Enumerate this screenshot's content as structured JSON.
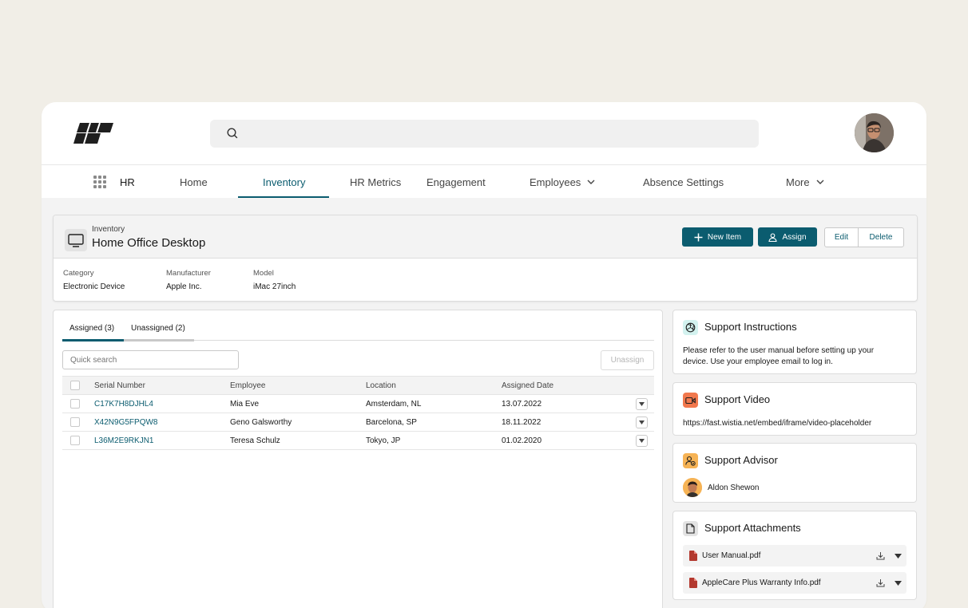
{
  "search": {
    "placeholder": ""
  },
  "nav": {
    "app_name": "HR",
    "items": [
      {
        "label": "Home"
      },
      {
        "label": "Inventory"
      },
      {
        "label": "HR Metrics"
      },
      {
        "label": "Engagement"
      },
      {
        "label": "Employees"
      },
      {
        "label": "Absence Settings"
      },
      {
        "label": "More"
      }
    ]
  },
  "record": {
    "object": "Inventory",
    "title": "Home Office Desktop",
    "buttons": {
      "new_item": "New Item",
      "assign": "Assign",
      "edit": "Edit",
      "delete": "Delete"
    },
    "fields": [
      {
        "label": "Category",
        "value": "Electronic Device"
      },
      {
        "label": "Manufacturer",
        "value": "Apple Inc."
      },
      {
        "label": "Model",
        "value": "iMac 27inch"
      }
    ]
  },
  "assignments": {
    "tabs": [
      {
        "label": "Assigned (3)"
      },
      {
        "label": "Unassigned (2)"
      }
    ],
    "quick_search_placeholder": "Quick search",
    "unassign_label": "Unassign",
    "columns": [
      "Serial Number",
      "Employee",
      "Location",
      "Assigned Date"
    ],
    "rows": [
      {
        "serial": "C17K7H8DJHL4",
        "employee": "Mia Eve",
        "location": "Amsterdam, NL",
        "date": "13.07.2022"
      },
      {
        "serial": "X42N9G5FPQW8",
        "employee": "Geno Galsworthy",
        "location": "Barcelona, SP",
        "date": "18.11.2022"
      },
      {
        "serial": "L36M2E9RKJN1",
        "employee": "Teresa Schulz",
        "location": "Tokyo, JP",
        "date": "01.02.2020"
      }
    ]
  },
  "side": {
    "instructions": {
      "title": "Support Instructions",
      "text_line1": "Please refer to the user manual before setting up your",
      "text_line2": "device. Use your employee email to log in."
    },
    "video": {
      "title": "Support Video",
      "url": "https://fast.wistia.net/embed/iframe/video-placeholder"
    },
    "advisor": {
      "title": "Support Advisor",
      "name": "Aldon Shewon"
    },
    "attachments": {
      "title": "Support Attachments",
      "files": [
        {
          "name": "User Manual.pdf"
        },
        {
          "name": "AppleCare Plus Warranty Info.pdf"
        }
      ]
    }
  },
  "colors": {
    "brand": "#0b5c6f",
    "background": "#f1eee7",
    "video_icon": "#f1784d",
    "advisor_icon": "#f6b355",
    "instructions_icon": "#d3f2ef"
  }
}
